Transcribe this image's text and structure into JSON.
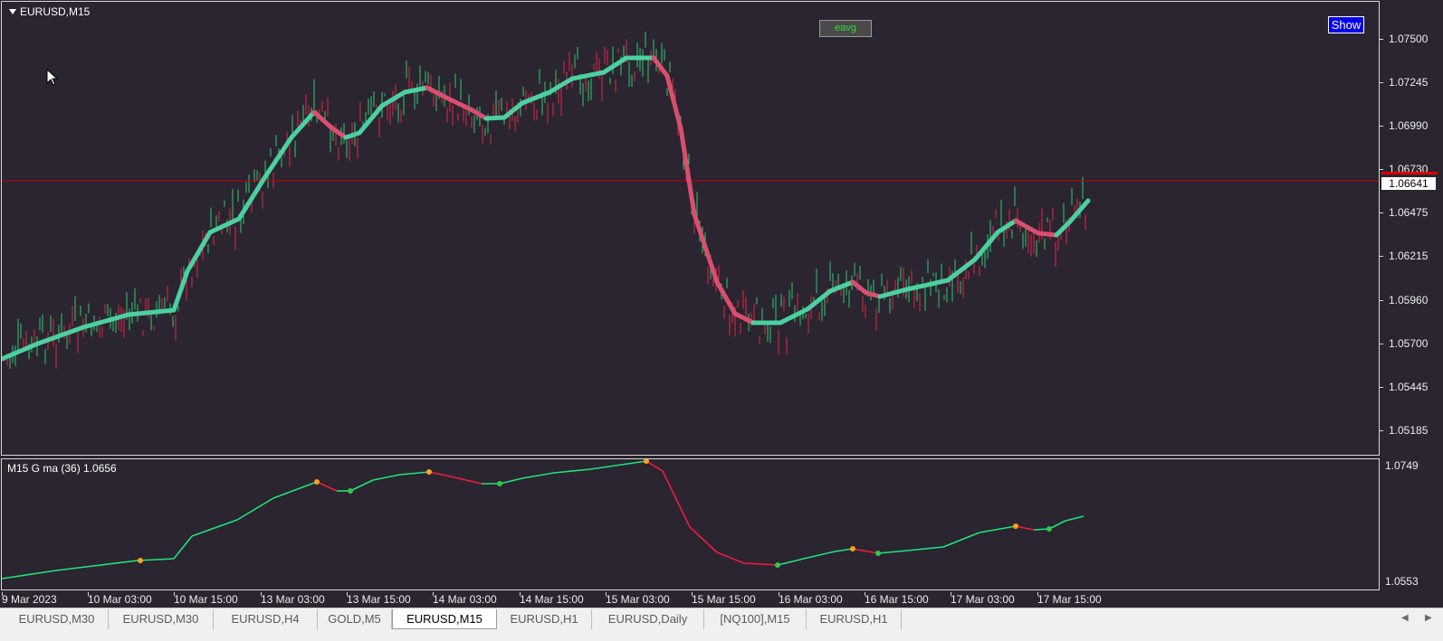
{
  "window": {
    "symbol_title": "EURUSD,M15",
    "eavg_button": "eavg",
    "show_button": "Show",
    "indicator_label": "M15 G ma (36) 1.0656"
  },
  "price_axis": {
    "labels": [
      "1.07500",
      "1.07245",
      "1.06990",
      "1.06730",
      "1.06475",
      "1.06215",
      "1.05960",
      "1.05700",
      "1.05445",
      "1.05185"
    ],
    "current_price": "1.06641"
  },
  "indicator_axis": {
    "labels": [
      "1.0749",
      "1.0553"
    ]
  },
  "time_axis": {
    "labels": [
      "9 Mar 2023",
      "10 Mar 03:00",
      "10 Mar 15:00",
      "13 Mar 03:00",
      "13 Mar 15:00",
      "14 Mar 03:00",
      "14 Mar 15:00",
      "15 Mar 03:00",
      "15 Mar 15:00",
      "16 Mar 03:00",
      "16 Mar 15:00",
      "17 Mar 03:00",
      "17 Mar 15:00"
    ]
  },
  "tabs": [
    {
      "label": "EURUSD,M30",
      "active": false
    },
    {
      "label": "EURUSD,M30",
      "active": false
    },
    {
      "label": "EURUSD,H4",
      "active": false
    },
    {
      "label": "GOLD,M5",
      "active": false
    },
    {
      "label": "EURUSD,M15",
      "active": true
    },
    {
      "label": "EURUSD,H1",
      "active": false
    },
    {
      "label": "EURUSD,Daily",
      "active": false
    },
    {
      "label": "[NQ100],M15",
      "active": false
    },
    {
      "label": "EURUSD,H1",
      "active": false
    }
  ],
  "colors": {
    "background": "#2a2530",
    "bull_candle": "#2ecc71",
    "bear_candle": "#e0264a",
    "ma_up": "#4cd0a0",
    "ma_down": "#d94f6e",
    "indicator_up": "#22e27a",
    "indicator_down": "#ee1c3c",
    "turn_up_dot": "#2ec84a",
    "turn_down_dot": "#ffa020",
    "price_line": "#c00000"
  },
  "icons": {
    "symbol_menu": "triangle-down-icon",
    "cursor": "mouse-pointer-icon",
    "scroll_left": "chevron-left-icon",
    "scroll_right": "chevron-right-icon"
  }
}
